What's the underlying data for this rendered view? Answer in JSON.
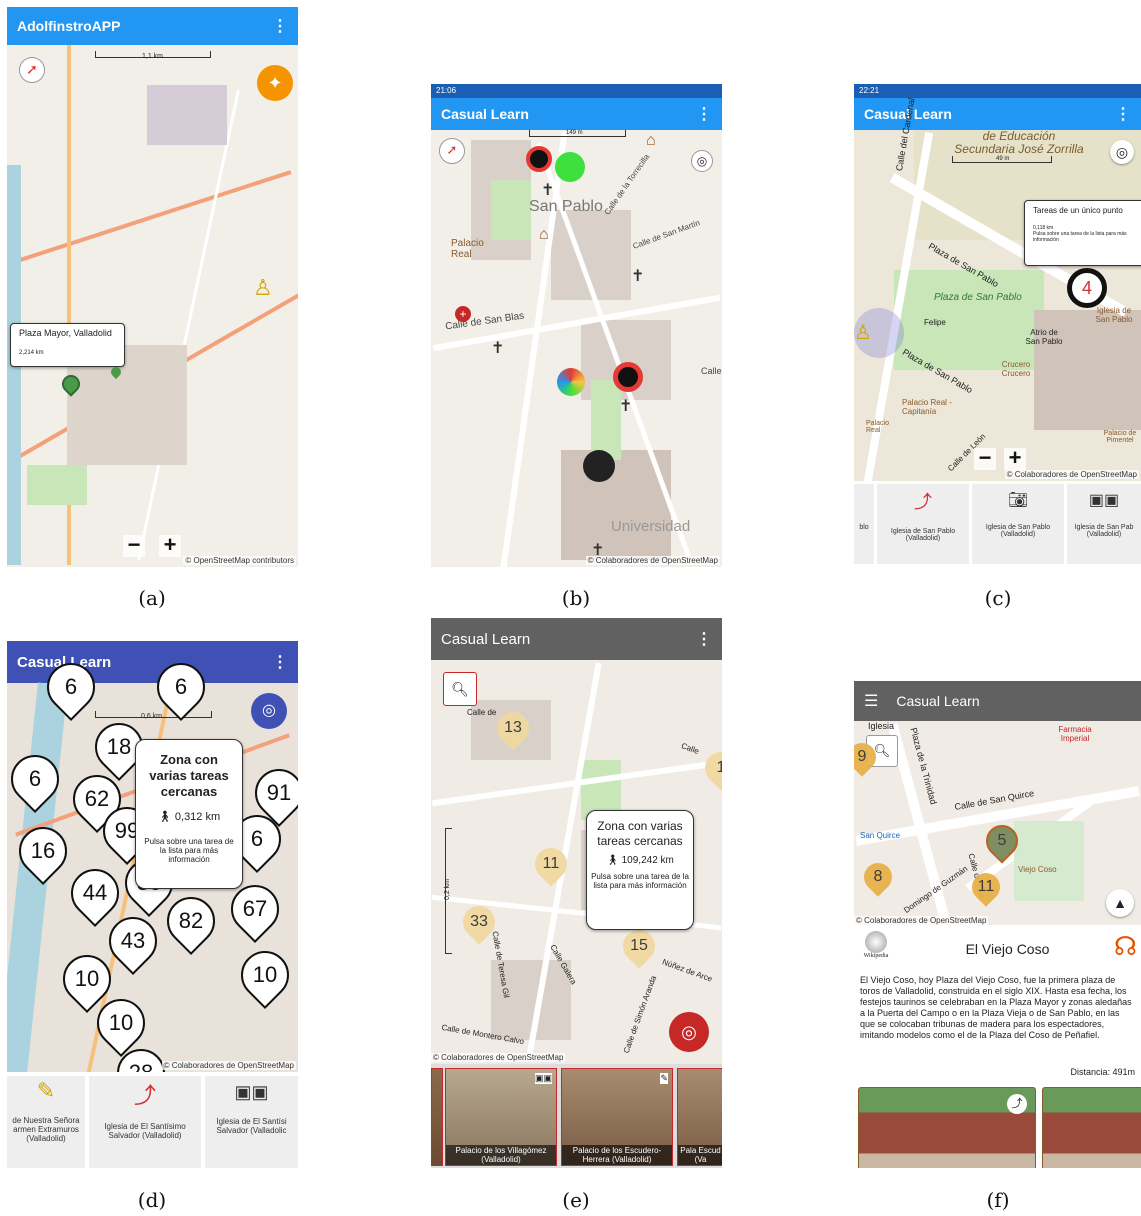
{
  "panels": {
    "a": {
      "caption": "(a)",
      "app_title": "AdolfinstroAPP",
      "menu_icon": "⋮",
      "scale_label": "1,1 km",
      "popup_title": "Plaza Mayor, Valladolid",
      "popup_distance": "2,214 km",
      "zoom_out": "−",
      "zoom_in": "+",
      "attribution": "© OpenStreetMap contributors",
      "appbar_color": "#2196f3"
    },
    "b": {
      "caption": "(b)",
      "status_time": "21:06",
      "app_title": "Casual Learn",
      "menu_icon": "⋮",
      "scale_label": "149 m",
      "labels": [
        "San Pablo",
        "Palacio Real",
        "Calle de San Blas",
        "Calle de la Torrecilla",
        "Calle de San Martín",
        "Universidad",
        "Calle"
      ],
      "attribution": "© Colaboradores de OpenStreetMap",
      "appbar_color": "#2196f3"
    },
    "c": {
      "caption": "(c)",
      "status_time": "22:21",
      "app_title": "Casual Learn",
      "menu_icon": "⋮",
      "scale_label": "49 m",
      "map_title": "de Educación Secundaria José Zorrilla",
      "popup_title": "Tareas de un único punto",
      "popup_distance": "0,118 km",
      "popup_hint": "Pulsa sobre una tarea de la lista para más información",
      "marker_count": "4",
      "labels": [
        "Calle del Cardenal",
        "Plaza de San Pablo",
        "Plaza de San Pablo",
        "Felipe",
        "Plaza de San Pablo",
        "Atrio de San Pablo",
        "Crucero Crucero",
        "Iglesia de San Pablo",
        "Palacio Real - Capitanía",
        "Palacio Real",
        "Palacio de Pimentel",
        "Calle de León"
      ],
      "attribution": "© Colaboradores de OpenStreetMap",
      "cards": [
        "blo",
        "Iglesia de San Pablo (Valladolid)",
        "Iglesia de San Pablo (Valladolid)",
        "Iglesia de San Pab (Valladolid)"
      ],
      "zoom_out": "−",
      "zoom_in": "+",
      "appbar_color": "#2196f3"
    },
    "d": {
      "caption": "(d)",
      "app_title": "Casual Learn",
      "menu_icon": "⋮",
      "scale_label": "0,6 km",
      "popup_title": "Zona con varias tareas cercanas",
      "popup_distance": "0,312 km",
      "popup_hint": "Pulsa sobre una tarea de la lista para más información",
      "pins": [
        "6",
        "6",
        "18",
        "6",
        "62",
        "91",
        "99",
        "6",
        "16",
        "44",
        "86",
        "82",
        "67",
        "43",
        "10",
        "10",
        "10",
        "28"
      ],
      "attribution": "© Colaboradores de OpenStreetMap",
      "cards": [
        "de Nuestra Señora armen Extramuros (Valladolid)",
        "Iglesia de El Santísimo Salvador (Valladolid)",
        "Iglesia de El Santísi Salvador (Valladolic"
      ],
      "appbar_color": "#3f51b5"
    },
    "e": {
      "caption": "(e)",
      "app_title": "Casual Learn",
      "menu_icon": "⋮",
      "scale_label": "0,2 km",
      "popup_title": "Zona con varias tareas cercanas",
      "popup_distance": "109,242 km",
      "popup_hint": "Pulsa sobre una tarea de la lista para más información",
      "pins": [
        "13",
        "1",
        "11",
        "33",
        "15"
      ],
      "labels": [
        "Calle de",
        "Calle",
        "Calle Galera",
        "Calle de Teresa Gil",
        "Núñez de Arce",
        "Calle de Simón Aranda",
        "Calle de Montero Calvo"
      ],
      "attribution": "© Colaboradores de OpenStreetMap",
      "cards": [
        "Palacio de los Villagómez (Valladolid)",
        "Palacio de los Escudero-Herrera (Valladolid)",
        "Pala Escud (Va"
      ],
      "appbar_color": "#616161"
    },
    "f": {
      "caption": "(f)",
      "app_title": "Casual Learn",
      "menu_icon": "☰",
      "labels": [
        "Iglesia",
        "Plaza de la Trinidad",
        "Calle de San Quirce",
        "San Quirce",
        "Domingo de Guzmán",
        "Calle de Exp",
        "Farmacia Imperial",
        "Viejo Coso"
      ],
      "pins": [
        "9",
        "5",
        "8",
        "11"
      ],
      "attribution": "© Colaboradores de OpenStreetMap",
      "wiki_label": "Wikipedia",
      "place_title": "El Viejo Coso",
      "description": "El Viejo Coso, hoy Plaza del Viejo Coso, fue la primera plaza de toros de Valladolid, construida en el siglo XIX. Hasta esa fecha, los festejos taurinos se celebraban en la Plaza Mayor y zonas aledañas a la Puerta del Campo o en la Plaza Vieja o de San Pablo, en las que se colocaban tribunas de madera para los espectadores, imitando modelos como el de la Plaza del Coso de Peñafiel.",
      "distance": "Distancia: 491m",
      "appbar_color": "#616161"
    }
  }
}
